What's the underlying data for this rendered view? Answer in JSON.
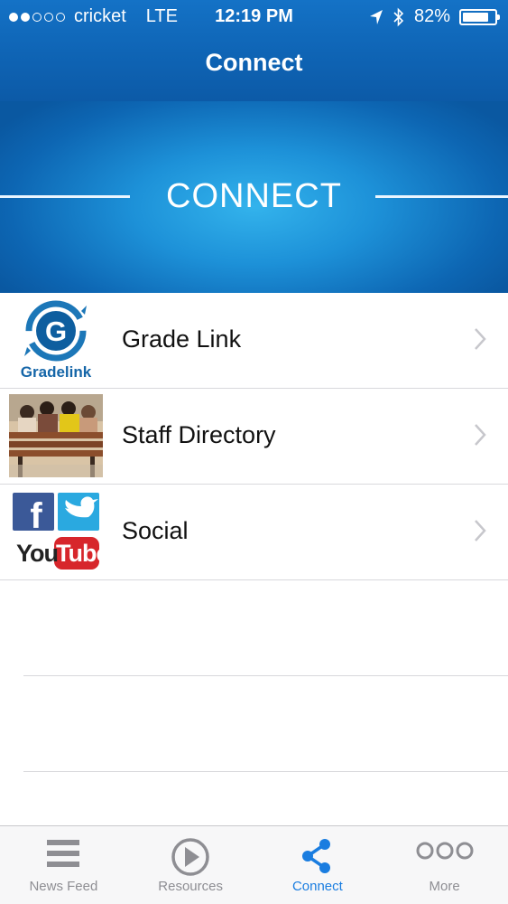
{
  "status_bar": {
    "carrier": "cricket",
    "network": "LTE",
    "time": "12:19 PM",
    "battery": "82%",
    "battery_level": 0.82,
    "signal_bars_filled": 2,
    "signal_bars_total": 5
  },
  "nav": {
    "title": "Connect"
  },
  "banner": {
    "title": "CONNECT"
  },
  "list": {
    "items": [
      {
        "label": "Grade Link",
        "thumbnail_text": "Gradelink",
        "thumbnail_icon": "gradelink-logo"
      },
      {
        "label": "Staff Directory",
        "thumbnail_icon": "people-on-bench-photo"
      },
      {
        "label": "Social",
        "thumbnail_text_youtube": "You",
        "thumbnail_text_tube": "Tube",
        "thumbnail_icon": "facebook-twitter-youtube-logos"
      }
    ]
  },
  "tabbar": {
    "tabs": [
      {
        "label": "News Feed",
        "icon": "list-icon"
      },
      {
        "label": "Resources",
        "icon": "play-icon"
      },
      {
        "label": "Connect",
        "icon": "share-icon",
        "active": true
      },
      {
        "label": "More",
        "icon": "more-icon"
      }
    ]
  },
  "colors": {
    "header_blue": "#0f65b6",
    "banner_center": "#33b3ec",
    "active_tab": "#1a7de0",
    "inactive_tab": "#8e8e93"
  }
}
